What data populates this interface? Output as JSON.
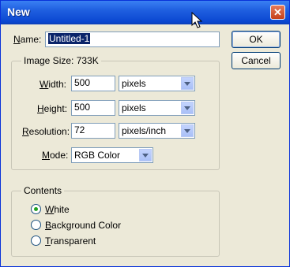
{
  "window": {
    "title": "New",
    "close_glyph": "✕"
  },
  "name": {
    "label_u": "N",
    "label_rest": "ame:",
    "value": "Untitled-1"
  },
  "buttons": {
    "ok": "OK",
    "cancel": "Cancel"
  },
  "image_size": {
    "legend": "Image Size:  733K",
    "width": {
      "label_u": "W",
      "label_rest": "idth:",
      "value": "500",
      "unit": "pixels"
    },
    "height": {
      "label_u": "H",
      "label_rest": "eight:",
      "value": "500",
      "unit": "pixels"
    },
    "resolution": {
      "label_u": "R",
      "label_rest": "esolution:",
      "value": "72",
      "unit": "pixels/inch"
    },
    "mode": {
      "label_u": "M",
      "label_rest": "ode:",
      "value": "RGB Color"
    }
  },
  "contents": {
    "legend": "Contents",
    "options": [
      {
        "u": "W",
        "rest": "hite",
        "checked": true
      },
      {
        "u": "B",
        "rest": "ackground Color",
        "checked": false
      },
      {
        "u": "T",
        "rest": "ransparent",
        "checked": false
      }
    ]
  }
}
